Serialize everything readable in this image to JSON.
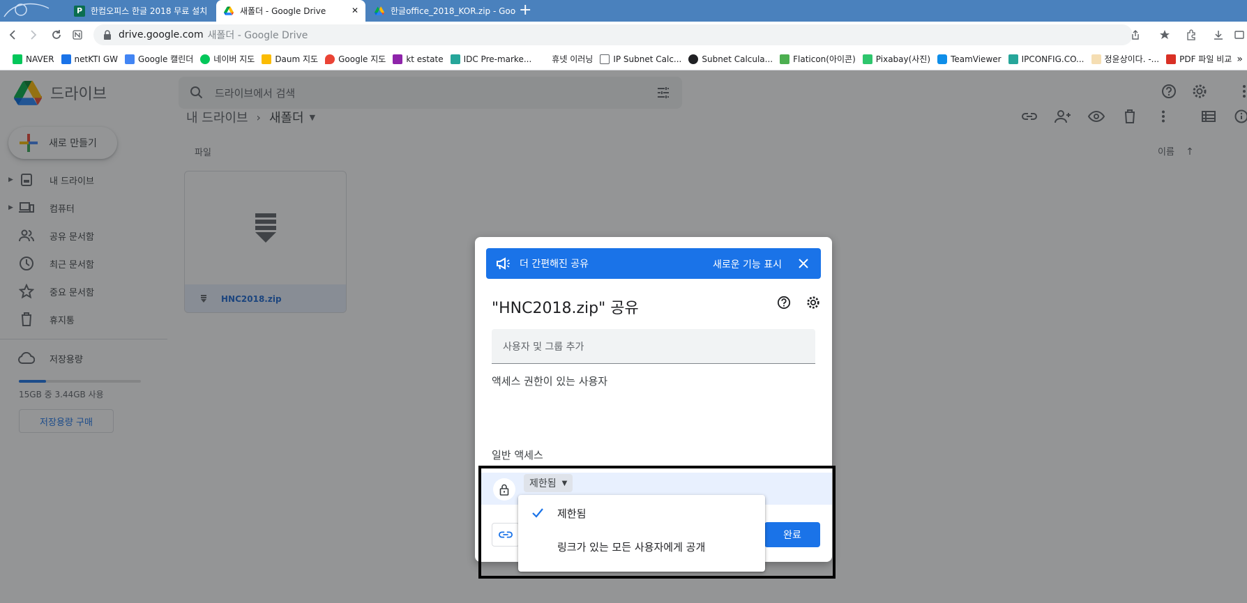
{
  "browser": {
    "tabs": [
      {
        "label": "한컴오피스 한글 2018 무료 설치",
        "active": false
      },
      {
        "label": "새폴더 - Google Drive",
        "active": true
      },
      {
        "label": "한글office_2018_KOR.zip - Goog",
        "active": false
      }
    ],
    "url_host": "drive.google.com",
    "url_title": "새폴더 - Google Drive",
    "bookmarks": [
      {
        "label": "NAVER",
        "color": "#03c75a"
      },
      {
        "label": "netKTI GW",
        "color": "#1a73e8"
      },
      {
        "label": "Google 캘린더",
        "color": "#4285f4"
      },
      {
        "label": "네이버 지도",
        "color": "#03c75a"
      },
      {
        "label": "Daum 지도",
        "color": "#fbbc04"
      },
      {
        "label": "Google 지도",
        "color": "#ea4335"
      },
      {
        "label": "kt estate",
        "color": "#8e24aa"
      },
      {
        "label": "IDC Pre-marke...",
        "color": "#26a69a"
      },
      {
        "label": "휴넷 이러닝",
        "color": "#ffffff"
      },
      {
        "label": "IP Subnet Calc...",
        "color": "#5f6368"
      },
      {
        "label": "Subnet Calcula...",
        "color": "#202124"
      },
      {
        "label": "Flaticon(아이콘)",
        "color": "#4caf50"
      },
      {
        "label": "Pixabay(사진)",
        "color": "#2ec66d"
      },
      {
        "label": "TeamViewer",
        "color": "#0e8ee9"
      },
      {
        "label": "IPCONFIG.CO...",
        "color": "#26a69a"
      },
      {
        "label": "정윤상이다. -...",
        "color": "#f5deb3"
      },
      {
        "label": "PDF 파일 비교",
        "color": "#d93025"
      }
    ],
    "overflow": "»"
  },
  "drive": {
    "logo_text": "드라이브",
    "search_placeholder": "드라이브에서 검색",
    "new_button": "새로 만들기",
    "sidebar": [
      {
        "label": "내 드라이브",
        "icon": "my-drive-icon",
        "caret": true
      },
      {
        "label": "컴퓨터",
        "icon": "computer-icon",
        "caret": true
      },
      {
        "label": "공유 문서함",
        "icon": "shared-icon",
        "caret": false
      },
      {
        "label": "최근 문서함",
        "icon": "clock-icon",
        "caret": false
      },
      {
        "label": "중요 문서함",
        "icon": "star-icon",
        "caret": false
      },
      {
        "label": "휴지통",
        "icon": "trash-icon",
        "caret": false
      }
    ],
    "storage_label": "저장용량",
    "storage_fraction": 0.22,
    "storage_text": "15GB 중 3.44GB 사용",
    "buy_storage": "저장용량 구매",
    "breadcrumb_root": "내 드라이브",
    "breadcrumb_current": "새폴더",
    "section_label": "파일",
    "sort_label": "이름",
    "file_name": "HNC2018.zip"
  },
  "dialog": {
    "banner_text": "더 간편해진 공유",
    "banner_link": "새로운 기능 표시",
    "title": "\"HNC2018.zip\" 공유",
    "add_placeholder": "사용자 및 그룹 추가",
    "access_heading": "액세스 권한이 있는 사용자",
    "general_heading": "일반 액세스",
    "restriction_value": "제한됨",
    "done_button": "완료"
  },
  "menu": {
    "items": [
      {
        "label": "제한됨",
        "checked": true
      },
      {
        "label": "링크가 있는 모든 사용자에게 공개",
        "checked": false
      }
    ]
  },
  "colors": {
    "accent": "#1a73e8",
    "tabstrip": "#4a81bd"
  }
}
